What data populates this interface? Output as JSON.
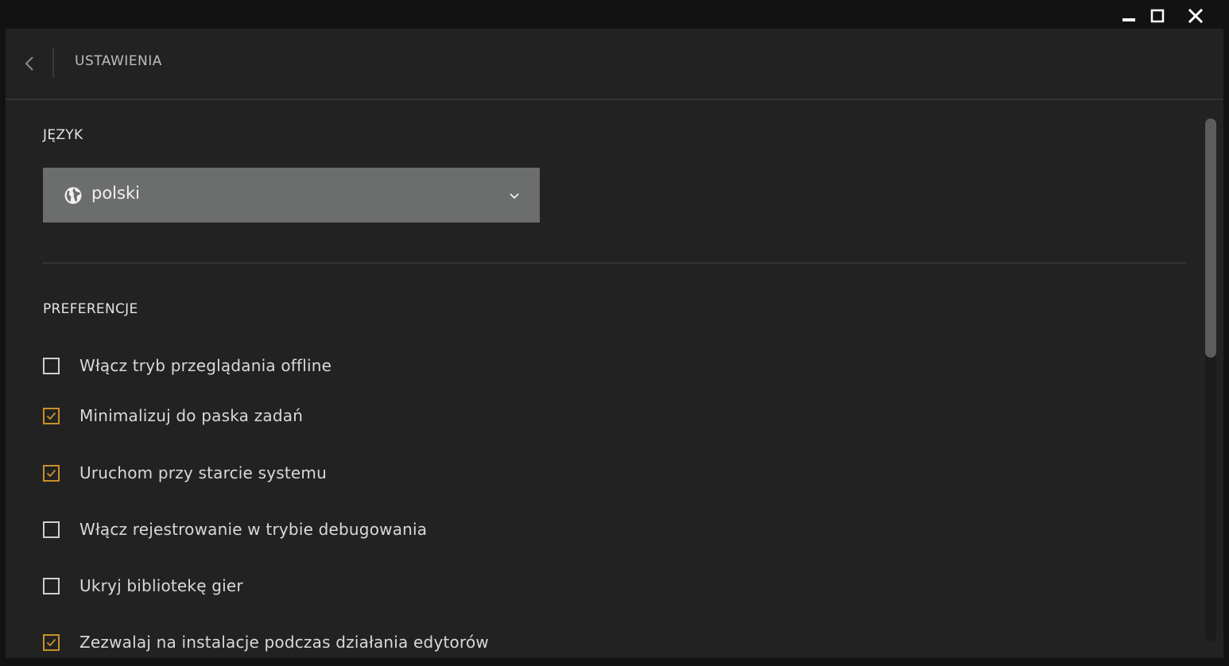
{
  "window": {
    "controls": {
      "minimize_icon": "minimize-icon",
      "maximize_icon": "maximize-icon",
      "close_icon": "close-icon"
    }
  },
  "header": {
    "back_icon": "chevron-left-icon",
    "title": "USTAWIENIA"
  },
  "language": {
    "section_title": "JĘZYK",
    "selected": "polski",
    "icon": "globe-icon",
    "dropdown_icon": "chevron-down-icon"
  },
  "preferences": {
    "section_title": "PREFERENCJE",
    "items": [
      {
        "label": "Włącz tryb przeglądania offline",
        "checked": false
      },
      {
        "label": "Minimalizuj do paska zadań",
        "checked": true
      },
      {
        "label": "Uruchom przy starcie systemu",
        "checked": true
      },
      {
        "label": "Włącz rejestrowanie w trybie debugowania",
        "checked": false
      },
      {
        "label": "Ukryj bibliotekę gier",
        "checked": false
      },
      {
        "label": "Zezwalaj na instalacje podczas działania edytorów",
        "checked": true
      }
    ]
  },
  "colors": {
    "accent": "#c8912a",
    "background": "#222222",
    "select_background": "#6b6e6c"
  }
}
